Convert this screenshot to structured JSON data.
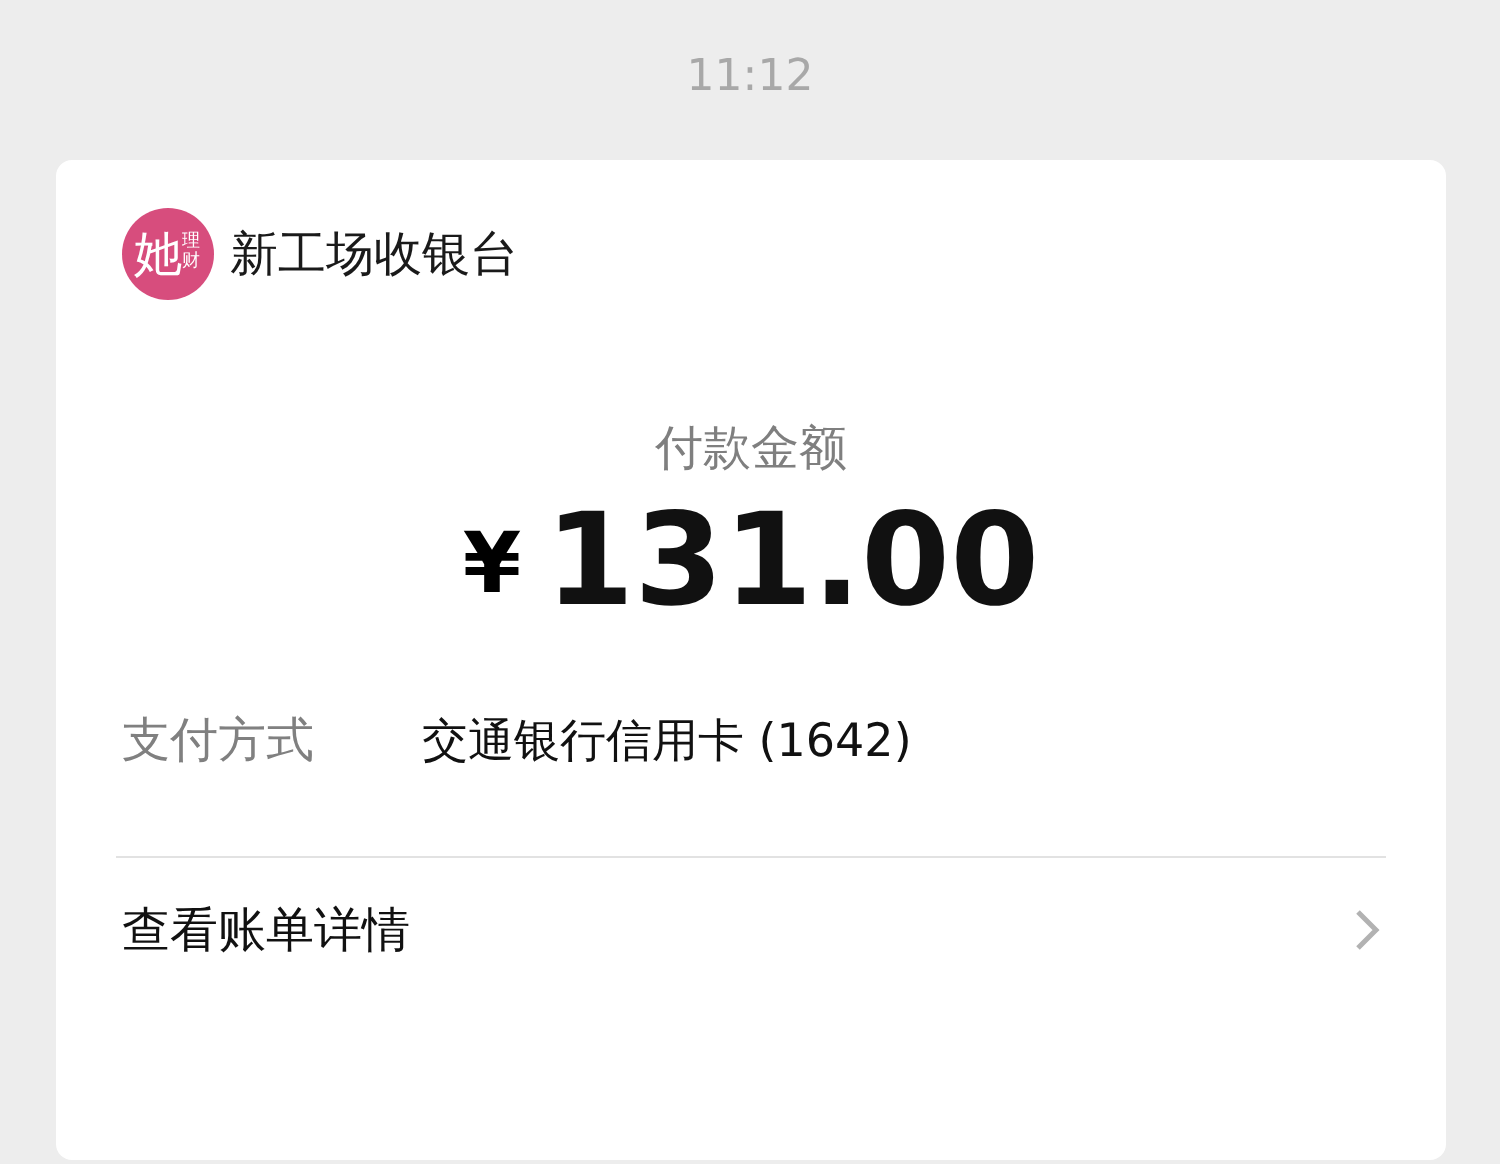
{
  "timestamp": "11:12",
  "merchant": {
    "logo_main": "她",
    "logo_sub": "理财",
    "name": "新工场收银台"
  },
  "payment": {
    "label": "付款金额",
    "currency": "¥",
    "amount": "131.00"
  },
  "method": {
    "label": "支付方式",
    "value": "交通银行信用卡 (1642)"
  },
  "details_link": {
    "label": "查看账单详情"
  }
}
